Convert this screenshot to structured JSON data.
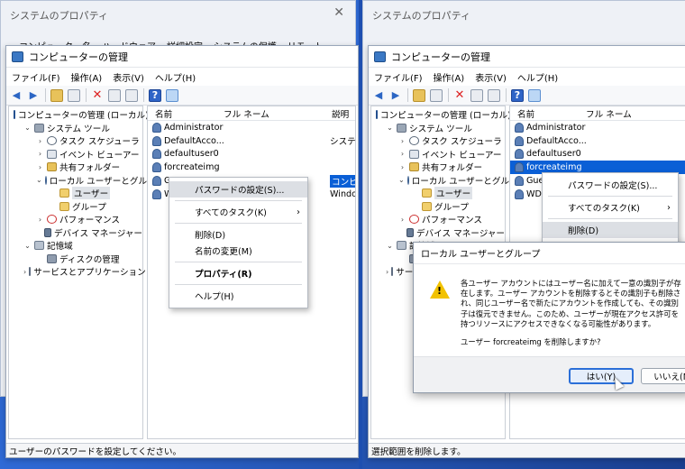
{
  "bg_window": {
    "title": "システムのプロパティ",
    "close": "✕",
    "tabs": [
      "コンピューター名",
      "ハードウェア",
      "詳細設定",
      "システムの保護",
      "リモート"
    ]
  },
  "mmc": {
    "title": "コンピューターの管理",
    "menu": [
      "ファイル(F)",
      "操作(A)",
      "表示(V)",
      "ヘルプ(H)"
    ],
    "tree": [
      {
        "exp": "",
        "icon": "computer-icon",
        "label": "コンピューターの管理 (ローカル)",
        "lvl": 0
      },
      {
        "exp": "⌄",
        "icon": "tools-icon",
        "label": "システム ツール",
        "lvl": 1
      },
      {
        "exp": "›",
        "icon": "clock-icon",
        "label": "タスク スケジューラ",
        "lvl": 2
      },
      {
        "exp": "›",
        "icon": "event-icon",
        "label": "イベント ビューアー",
        "lvl": 2
      },
      {
        "exp": "›",
        "icon": "shared-folder-icon",
        "label": "共有フォルダー",
        "lvl": 2
      },
      {
        "exp": "⌄",
        "icon": "users-icon",
        "label": "ローカル ユーザーとグループ",
        "lvl": 2
      },
      {
        "exp": "",
        "icon": "folder-icon",
        "label": "ユーザー",
        "lvl": 3,
        "selected": true
      },
      {
        "exp": "",
        "icon": "folder-icon",
        "label": "グループ",
        "lvl": 3
      },
      {
        "exp": "›",
        "icon": "performance-icon",
        "label": "パフォーマンス",
        "lvl": 2
      },
      {
        "exp": "",
        "icon": "device-icon",
        "label": "デバイス マネージャー",
        "lvl": 2
      },
      {
        "exp": "⌄",
        "icon": "storage-icon",
        "label": "記憶域",
        "lvl": 1
      },
      {
        "exp": "",
        "icon": "disk-icon",
        "label": "ディスクの管理",
        "lvl": 2
      },
      {
        "exp": "›",
        "icon": "services-icon",
        "label": "サービスとアプリケーション",
        "lvl": 1
      }
    ]
  },
  "left": {
    "columns": [
      "名前",
      "フル ネーム",
      "説明"
    ],
    "users": [
      {
        "name": "Administrator",
        "desc": ""
      },
      {
        "name": "DefaultAcco...",
        "desc": "システムで"
      },
      {
        "name": "defaultuser0",
        "desc": ""
      },
      {
        "name": "forcreateimg",
        "desc": ""
      },
      {
        "name": "G",
        "desc": "コンピュータ",
        "highlight_desc": true
      },
      {
        "name": "W",
        "desc": "Window"
      }
    ],
    "context_menu": [
      {
        "label": "パスワードの設定(S)...",
        "hover": true
      },
      {
        "sep": true
      },
      {
        "label": "すべてのタスク(K)",
        "arrow": "›"
      },
      {
        "sep": true
      },
      {
        "label": "削除(D)"
      },
      {
        "label": "名前の変更(M)"
      },
      {
        "sep": true
      },
      {
        "label": "プロパティ(R)",
        "bold": true
      },
      {
        "sep": true
      },
      {
        "label": "ヘルプ(H)"
      }
    ],
    "status": "ユーザーのパスワードを設定してください。"
  },
  "right": {
    "columns": [
      "名前",
      "フル ネーム"
    ],
    "users": [
      {
        "name": "Administrator"
      },
      {
        "name": "DefaultAcco..."
      },
      {
        "name": "defaultuser0"
      },
      {
        "name": "forcreateimg",
        "highlight": true
      },
      {
        "name": "Gue"
      },
      {
        "name": "WD"
      }
    ],
    "context_menu": [
      {
        "label": "パスワードの設定(S)..."
      },
      {
        "sep": true
      },
      {
        "label": "すべてのタスク(K)",
        "arrow": "›"
      },
      {
        "sep": true
      },
      {
        "label": "削除(D)",
        "hover": true
      },
      {
        "label": "名前の変更(M)"
      }
    ],
    "status": "選択範囲を削除します。",
    "dialog": {
      "title": "ローカル ユーザーとグループ",
      "message": "各ユーザー アカウントにはユーザー名に加えて一意の識別子が存在します。ユーザー アカウントを削除するとその識別子も削除され、同じユーザー名で新たにアカウントを作成しても、その識別子は復元できません。このため、ユーザーが現在アクセス許可を持つリソースにアクセスできなくなる可能性があります。",
      "question": "ユーザー forcreateimg を削除しますか?",
      "yes": "はい(Y)",
      "no": "いいえ(N)"
    }
  }
}
